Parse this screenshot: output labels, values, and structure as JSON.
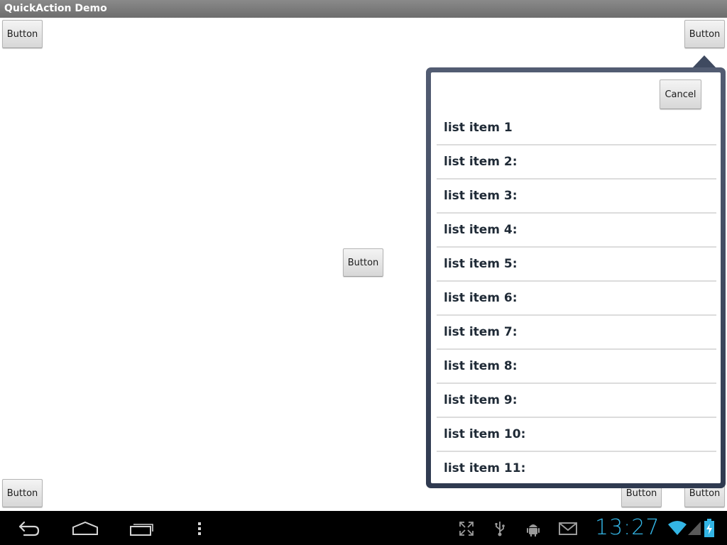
{
  "app": {
    "title": "QuickAction Demo"
  },
  "buttons": {
    "top_left": "Button",
    "top_right": "Button",
    "center": "Button",
    "bottom_left": "Button",
    "bottom_middle": "Button",
    "bottom_right": "Button"
  },
  "popup": {
    "cancel_label": "Cancel",
    "items": [
      {
        "label": "list item 1"
      },
      {
        "label": "list item 2:"
      },
      {
        "label": "list item 3:"
      },
      {
        "label": "list item 4:"
      },
      {
        "label": "list item 5:"
      },
      {
        "label": "list item 6:"
      },
      {
        "label": "list item 7:"
      },
      {
        "label": "list item 8:"
      },
      {
        "label": "list item 9:"
      },
      {
        "label": "list item 10:"
      },
      {
        "label": "list item 11:"
      }
    ]
  },
  "system_bar": {
    "time": "13:27",
    "icons": [
      "back-icon",
      "home-icon",
      "recent-apps-icon",
      "menu-icon",
      "fullscreen-icon",
      "usb-icon",
      "android-debug-icon",
      "gmail-icon",
      "wifi-icon",
      "signal-icon",
      "battery-charging-icon"
    ],
    "accent_color": "#33b5e5"
  }
}
